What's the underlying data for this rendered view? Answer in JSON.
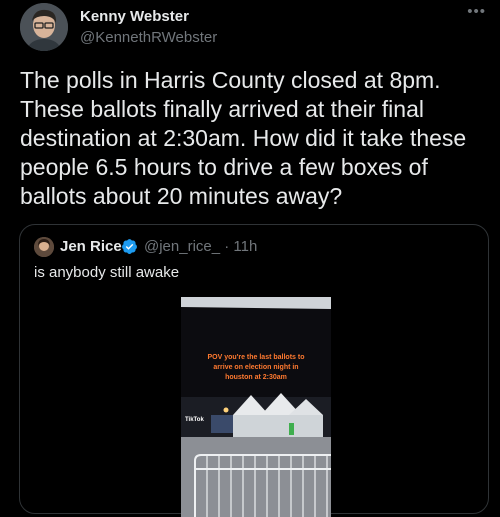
{
  "author": {
    "name": "Kenny Webster",
    "handle": "@KennethRWebster"
  },
  "more_icon": "more-horizontal-icon",
  "tweet": {
    "text": "The polls in Harris County closed at 8pm.\nThese ballots finally arrived at their final destination at 2:30am. How did it take these people 6.5 hours to drive a few boxes of ballots about 20 minutes away?"
  },
  "quoted": {
    "name": "Jen Rice",
    "handle_time": "@jen_rice_ · 11h",
    "text": "is anybody still awake",
    "verified_icon": "verified-badge-icon",
    "video": {
      "caption": "POV you're the last ballots to\narrive on election night in\nhouston at 2:30am",
      "watermark": "TikTok"
    }
  },
  "colors": {
    "background": "#000000",
    "text": "#e7e9ea",
    "muted": "#71767b",
    "verified": "#1d9bf0",
    "border": "#2f3336",
    "caption": "#ff7a30"
  }
}
